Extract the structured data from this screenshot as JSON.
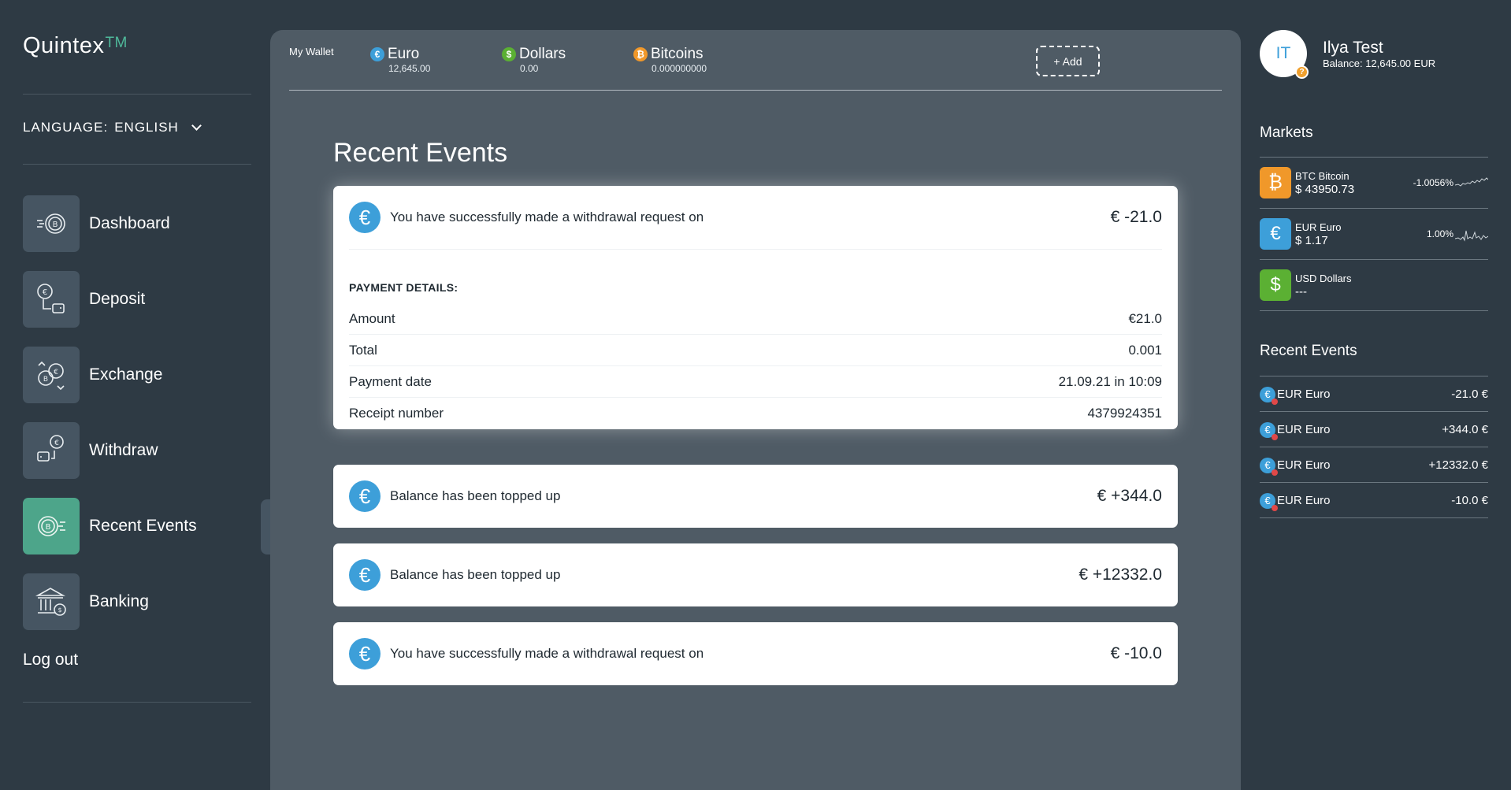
{
  "brand": {
    "name": "Quintex",
    "tm": "TM"
  },
  "language": {
    "label": "LANGUAGE:",
    "value": "ENGLISH"
  },
  "nav": [
    {
      "label": "Dashboard",
      "icon": "bitcoin-speed-icon"
    },
    {
      "label": "Deposit",
      "icon": "deposit-icon"
    },
    {
      "label": "Exchange",
      "icon": "exchange-icon"
    },
    {
      "label": "Withdraw",
      "icon": "withdraw-icon"
    },
    {
      "label": "Recent Events",
      "icon": "recent-events-icon",
      "active": true
    },
    {
      "label": "Banking",
      "icon": "bank-icon"
    }
  ],
  "logout": "Log out",
  "wallet": {
    "title": "My Wallet",
    "currencies": [
      {
        "name": "Euro",
        "balance": "12,645.00",
        "symbol": "€",
        "color": "#3d9fd9"
      },
      {
        "name": "Dollars",
        "balance": "0.00",
        "symbol": "$",
        "color": "#5bb033"
      },
      {
        "name": "Bitcoins",
        "balance": "0.000000000",
        "symbol": "₿",
        "color": "#f0982a"
      }
    ],
    "add_label": "+ Add"
  },
  "main": {
    "title": "Recent Events",
    "events": [
      {
        "text": "You have successfully made a withdrawal request on",
        "amount": "€ -21.0",
        "icon": "€",
        "expanded": true,
        "details": {
          "title": "PAYMENT DETAILS:",
          "rows": [
            {
              "label": "Amount",
              "value": "€21.0"
            },
            {
              "label": "Total",
              "value": "0.001"
            },
            {
              "label": "Payment date",
              "value": "21.09.21 in 10:09"
            },
            {
              "label": "Receipt number",
              "value": "4379924351"
            }
          ]
        }
      },
      {
        "text": "Balance has been topped up",
        "amount": "€ +344.0",
        "icon": "€"
      },
      {
        "text": "Balance has been topped up",
        "amount": "€ +12332.0",
        "icon": "€"
      },
      {
        "text": "You have successfully made a withdrawal request on",
        "amount": "€ -10.0",
        "icon": "€"
      }
    ]
  },
  "user": {
    "initials": "IT",
    "badge": "?",
    "name": "Ilya Test",
    "balance": "Balance: 12,645.00 EUR"
  },
  "markets": {
    "title": "Markets",
    "items": [
      {
        "name": "BTC Bitcoin",
        "price": "$ 43950.73",
        "change": "-1.0056%",
        "icon": "₿",
        "color": "#f0982a"
      },
      {
        "name": "EUR Euro",
        "price": "$ 1.17",
        "change": "1.00%",
        "icon": "€",
        "color": "#3d9fd9"
      },
      {
        "name": "USD Dollars",
        "price": "---",
        "change": "",
        "icon": "$",
        "color": "#5bb033"
      }
    ]
  },
  "recent_events_panel": {
    "title": "Recent Events",
    "items": [
      {
        "label": "EUR Euro",
        "amount": "-21.0 €"
      },
      {
        "label": "EUR Euro",
        "amount": "+344.0 €"
      },
      {
        "label": "EUR Euro",
        "amount": "+12332.0 €"
      },
      {
        "label": "EUR Euro",
        "amount": "-10.0 €"
      }
    ]
  }
}
